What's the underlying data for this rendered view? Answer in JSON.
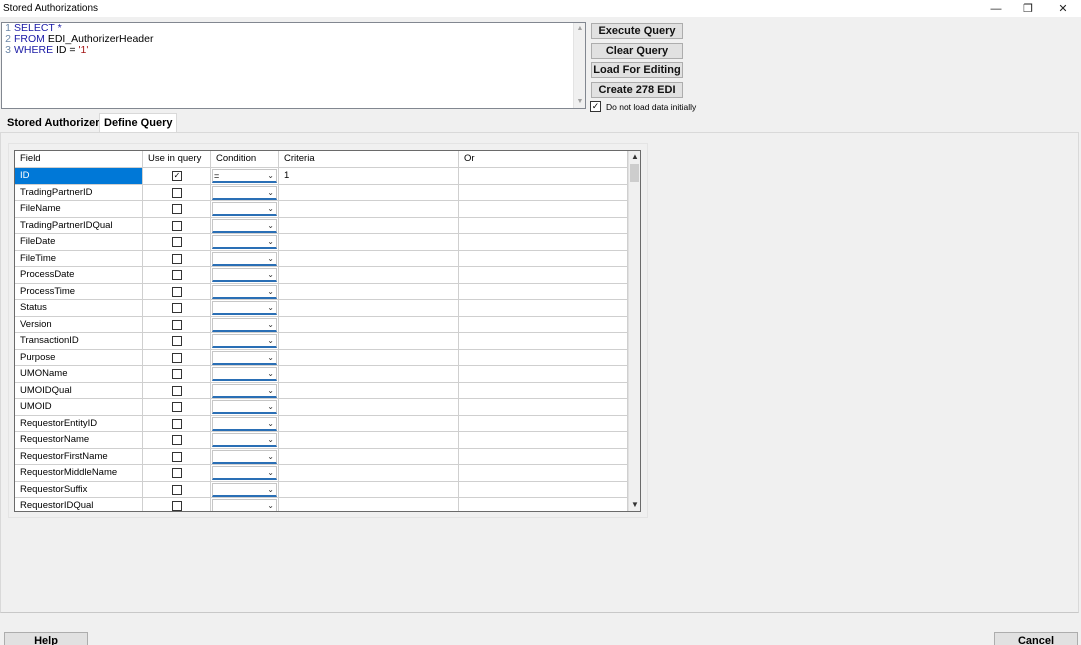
{
  "window": {
    "title": "Stored Authorizations",
    "controls": {
      "minimize": "—",
      "restore": "❐",
      "close": "✕"
    }
  },
  "editor": {
    "lines": [
      {
        "num": "1",
        "parts": [
          {
            "text": "SELECT *",
            "kind": "kw"
          }
        ]
      },
      {
        "num": "2",
        "parts": [
          {
            "text": "FROM ",
            "kind": "kw"
          },
          {
            "text": "EDI_AuthorizerHeader",
            "kind": "id"
          }
        ]
      },
      {
        "num": "3",
        "parts": [
          {
            "text": "WHERE ",
            "kind": "kw"
          },
          {
            "text": "ID = ",
            "kind": "id"
          },
          {
            "text": "'1'",
            "kind": "str"
          }
        ]
      }
    ]
  },
  "buttons": {
    "execute": "Execute Query",
    "clear": "Clear Query",
    "load": "Load For Editing",
    "create": "Create 278 EDI"
  },
  "option": {
    "label": "Do not load data initially",
    "checked": true
  },
  "tabs": {
    "stored": "Stored Authorizers",
    "define": "Define Query"
  },
  "grid": {
    "headers": {
      "field": "Field",
      "use": "Use in query",
      "condition": "Condition",
      "criteria": "Criteria",
      "or": "Or"
    },
    "rows": [
      {
        "field": "ID",
        "use": true,
        "condition": "=",
        "criteria": "1",
        "or": ""
      },
      {
        "field": "TradingPartnerID",
        "use": false,
        "condition": "",
        "criteria": "",
        "or": ""
      },
      {
        "field": "FileName",
        "use": false,
        "condition": "",
        "criteria": "",
        "or": ""
      },
      {
        "field": "TradingPartnerIDQual",
        "use": false,
        "condition": "",
        "criteria": "",
        "or": ""
      },
      {
        "field": "FileDate",
        "use": false,
        "condition": "",
        "criteria": "",
        "or": ""
      },
      {
        "field": "FileTime",
        "use": false,
        "condition": "",
        "criteria": "",
        "or": ""
      },
      {
        "field": "ProcessDate",
        "use": false,
        "condition": "",
        "criteria": "",
        "or": ""
      },
      {
        "field": "ProcessTime",
        "use": false,
        "condition": "",
        "criteria": "",
        "or": ""
      },
      {
        "field": "Status",
        "use": false,
        "condition": "",
        "criteria": "",
        "or": ""
      },
      {
        "field": "Version",
        "use": false,
        "condition": "",
        "criteria": "",
        "or": ""
      },
      {
        "field": "TransactionID",
        "use": false,
        "condition": "",
        "criteria": "",
        "or": ""
      },
      {
        "field": "Purpose",
        "use": false,
        "condition": "",
        "criteria": "",
        "or": ""
      },
      {
        "field": "UMOName",
        "use": false,
        "condition": "",
        "criteria": "",
        "or": ""
      },
      {
        "field": "UMOIDQual",
        "use": false,
        "condition": "",
        "criteria": "",
        "or": ""
      },
      {
        "field": "UMOID",
        "use": false,
        "condition": "",
        "criteria": "",
        "or": ""
      },
      {
        "field": "RequestorEntityID",
        "use": false,
        "condition": "",
        "criteria": "",
        "or": ""
      },
      {
        "field": "RequestorName",
        "use": false,
        "condition": "",
        "criteria": "",
        "or": ""
      },
      {
        "field": "RequestorFirstName",
        "use": false,
        "condition": "",
        "criteria": "",
        "or": ""
      },
      {
        "field": "RequestorMiddleName",
        "use": false,
        "condition": "",
        "criteria": "",
        "or": ""
      },
      {
        "field": "RequestorSuffix",
        "use": false,
        "condition": "",
        "criteria": "",
        "or": ""
      },
      {
        "field": "RequestorIDQual",
        "use": false,
        "condition": "",
        "criteria": "",
        "or": ""
      }
    ]
  },
  "footer": {
    "help": "Help",
    "cancel": "Cancel"
  },
  "colors": {
    "selection": "#0078d7",
    "keyword": "#1a1aa6",
    "string": "#a31515",
    "combo_underline": "#2a6fb5"
  },
  "icons": {
    "scroll_up": "chevron-up-icon",
    "scroll_down": "chevron-down-icon",
    "dropdown": "chevron-down-icon",
    "check": "check-icon"
  }
}
